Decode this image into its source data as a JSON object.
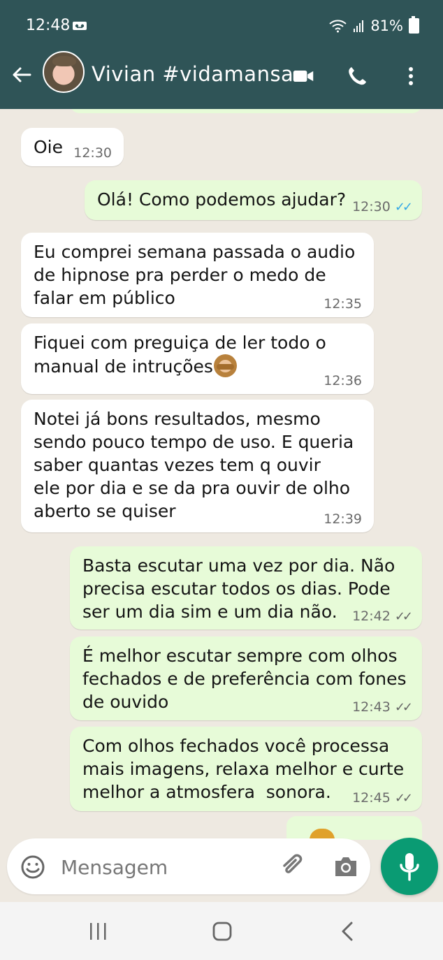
{
  "status_bar": {
    "time": "12:48",
    "battery": "81%",
    "icons": [
      "voicemail-icon",
      "wifi-icon",
      "signal-icon",
      "battery-icon"
    ]
  },
  "header": {
    "contact_name": "Vivian  #vidamansa",
    "icons": [
      "back-arrow-icon",
      "avatar",
      "video-call-icon",
      "phone-icon",
      "more-vertical-icon"
    ]
  },
  "messages": [
    {
      "type": "incoming",
      "text": "Oie",
      "time": "12:30"
    },
    {
      "type": "outgoing",
      "text": "Olá! Como podemos ajudar?",
      "time": "12:30",
      "ticks": "✓✓",
      "status": "read"
    },
    {
      "type": "incoming",
      "text": "Eu comprei semana passada o audio\nde hipnose pra perder o medo de\nfalar em público",
      "time": "12:35"
    },
    {
      "type": "incoming",
      "text": "Fiquei com preguiça de ler todo o\nmanual de intruções",
      "time": "12:36",
      "emoji": "see-no-evil-monkey-icon"
    },
    {
      "type": "incoming",
      "text": "Notei já bons resultados, mesmo\nsendo pouco tempo de uso. E queria\nsaber quantas vezes tem q ouvir\nele por dia e se da pra ouvir de olho\naberto se quiser",
      "time": "12:39"
    },
    {
      "type": "outgoing",
      "text": "Basta escutar uma vez por dia. Não\nprecisa escutar todos os dias. Pode\nser um dia sim e um dia não.",
      "time": "12:42",
      "ticks": "✓✓",
      "status": "delivered"
    },
    {
      "type": "outgoing",
      "text": "É melhor escutar sempre com olhos\nfechados e de preferência com fones\nde ouvido",
      "time": "12:43",
      "ticks": "✓✓",
      "status": "delivered"
    },
    {
      "type": "outgoing",
      "text": "Com olhos fechados você processa\nmais imagens, relaxa melhor e curte\nmelhor a atmosfera  sonora.",
      "time": "12:45",
      "ticks": "✓✓",
      "status": "delivered"
    }
  ],
  "composer": {
    "placeholder": "Mensagem",
    "icons": [
      "emoji-icon",
      "attach-icon",
      "camera-icon",
      "microphone-icon"
    ]
  },
  "navigation": {
    "icons": [
      "recent-apps-icon",
      "home-icon",
      "back-icon"
    ]
  },
  "colors": {
    "header": "#2f5457",
    "chat_background": "#eee9e1",
    "incoming_bubble": "#ffffff",
    "outgoing_bubble": "#e7fbd8",
    "accent": "#0a9b73",
    "read_ticks": "#32a7e6"
  }
}
